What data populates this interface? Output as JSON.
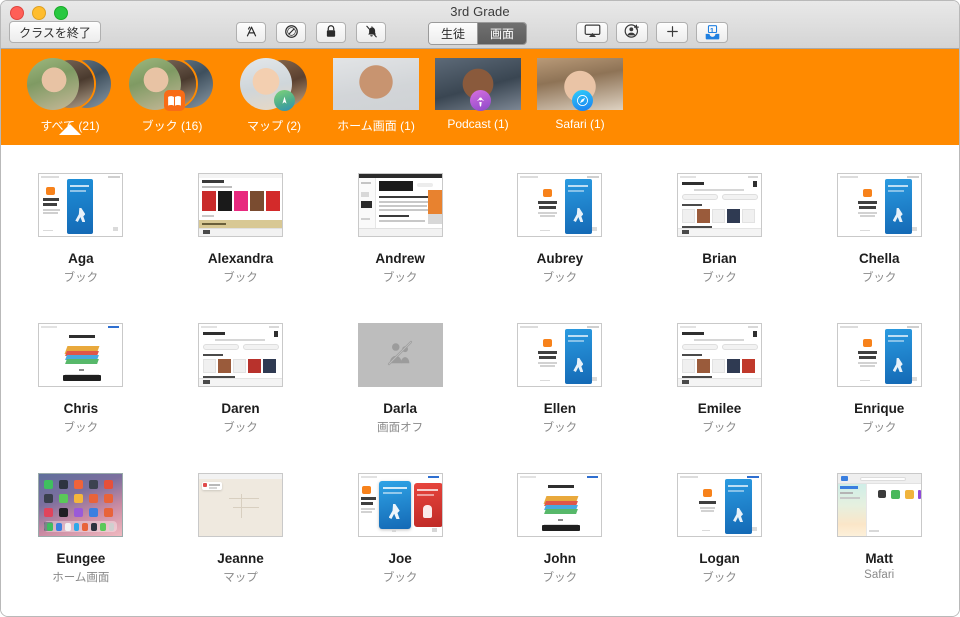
{
  "window": {
    "title": "3rd Grade",
    "traffic_lights": [
      "close",
      "minimize",
      "zoom"
    ]
  },
  "toolbar": {
    "end_class_label": "クラスを終了",
    "buttons": [
      {
        "name": "open-apps-button",
        "icon": "app-store-icon",
        "label": ""
      },
      {
        "name": "navigate-button",
        "icon": "navigate-icon",
        "label": ""
      },
      {
        "name": "lock-screens-button",
        "icon": "lock-icon",
        "label": ""
      },
      {
        "name": "mute-button",
        "icon": "bell-slash-icon",
        "label": ""
      },
      {
        "name": "airplay-button",
        "icon": "airplay-icon",
        "label": ""
      },
      {
        "name": "add-student-button",
        "icon": "person-add-icon",
        "label": ""
      },
      {
        "name": "add-button",
        "icon": "plus-icon",
        "label": ""
      },
      {
        "name": "inbox-button",
        "icon": "inbox-icon",
        "label": "1"
      }
    ],
    "inbox_count": "1",
    "segmented": {
      "options": [
        "生徒",
        "画面"
      ],
      "selected": "画面"
    }
  },
  "filter_bar": {
    "background_color": "#FF8A00",
    "selected_index": 0,
    "items": [
      {
        "label": "すべて (21)",
        "app": "all",
        "count": 21,
        "stacked": true,
        "badge": null
      },
      {
        "label": "ブック (16)",
        "app": "books",
        "count": 16,
        "stacked": true,
        "badge": "books-icon"
      },
      {
        "label": "マップ (2)",
        "app": "maps",
        "count": 2,
        "stacked": true,
        "badge": "maps-icon"
      },
      {
        "label": "ホーム画面 (1)",
        "app": "home",
        "count": 1,
        "stacked": false,
        "badge": null
      },
      {
        "label": "Podcast (1)",
        "app": "podcasts",
        "count": 1,
        "stacked": false,
        "badge": "podcasts-icon"
      },
      {
        "label": "Safari (1)",
        "app": "safari",
        "count": 1,
        "stacked": false,
        "badge": "safari-icon"
      }
    ]
  },
  "grid": {
    "rows": [
      [
        {
          "name": "Aga",
          "status": "ブック",
          "screen": "books-welcome"
        },
        {
          "name": "Alexandra",
          "status": "ブック",
          "screen": "books-store"
        },
        {
          "name": "Andrew",
          "status": "ブック",
          "screen": "books-reading"
        },
        {
          "name": "Aubrey",
          "status": "ブック",
          "screen": "books-welcome"
        },
        {
          "name": "Brian",
          "status": "ブック",
          "screen": "books-readingnow"
        },
        {
          "name": "Chella",
          "status": "ブック",
          "screen": "books-welcome"
        }
      ],
      [
        {
          "name": "Chris",
          "status": "ブック",
          "screen": "books-getstarted"
        },
        {
          "name": "Daren",
          "status": "ブック",
          "screen": "books-readingnow"
        },
        {
          "name": "Darla",
          "status": "画面オフ",
          "screen": "screen-off"
        },
        {
          "name": "Ellen",
          "status": "ブック",
          "screen": "books-welcome"
        },
        {
          "name": "Emilee",
          "status": "ブック",
          "screen": "books-readingnow"
        },
        {
          "name": "Enrique",
          "status": "ブック",
          "screen": "books-welcome"
        }
      ],
      [
        {
          "name": "Eungee",
          "status": "ホーム画面",
          "screen": "home-screen"
        },
        {
          "name": "Jeanne",
          "status": "マップ",
          "screen": "maps"
        },
        {
          "name": "Joe",
          "status": "ブック",
          "screen": "books-covers"
        },
        {
          "name": "John",
          "status": "ブック",
          "screen": "books-getstarted"
        },
        {
          "name": "Logan",
          "status": "ブック",
          "screen": "books-welcome"
        },
        {
          "name": "Matt",
          "status": "Safari",
          "screen": "safari"
        }
      ]
    ]
  }
}
